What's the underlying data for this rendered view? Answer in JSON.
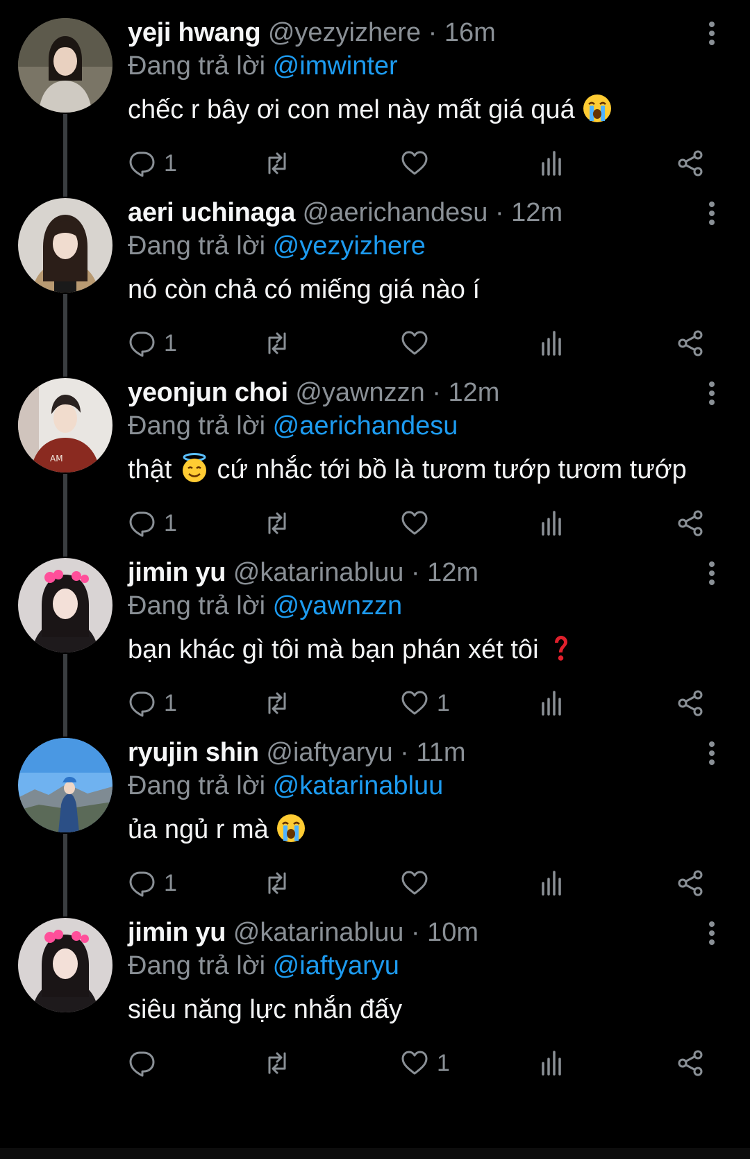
{
  "colors": {
    "background": "#000000",
    "name": "#f5f6f7",
    "muted": "#8a9096",
    "mention": "#1d9bf0",
    "thread_line": "#3a3d40"
  },
  "tweets": [
    {
      "name": "yeji hwang",
      "handle": "@yezyizhere",
      "separator": "·",
      "time": "16m",
      "reply_prefix": "Đang trả lời",
      "reply_to": "@imwinter",
      "text": "chếc r bây ơi con mel này mất giá quá",
      "text_after": "",
      "emoji": "loudly-crying-face",
      "reply_count": "1",
      "like_count": "",
      "avatar": "avatar-portrait-grey-sweater"
    },
    {
      "name": "aeri uchinaga",
      "handle": "@aerichandesu",
      "separator": "·",
      "time": "12m",
      "reply_prefix": "Đang trả lời",
      "reply_to": "@yezyizhere",
      "text": "nó còn chả có miếng giá nào í",
      "text_after": "",
      "emoji": "",
      "reply_count": "1",
      "like_count": "",
      "avatar": "avatar-portrait-long-hair"
    },
    {
      "name": "yeonjun choi",
      "handle": "@yawnzzn",
      "separator": "·",
      "time": "12m",
      "reply_prefix": "Đang trả lời",
      "reply_to": "@aerichandesu",
      "text": "thật",
      "text_after": "cứ nhắc tới bồ là tươm tướp tươm tướp",
      "emoji": "smiling-face-with-halo",
      "reply_count": "1",
      "like_count": "",
      "avatar": "avatar-portrait-red-hoodie"
    },
    {
      "name": "jimin yu",
      "handle": "@katarinabluu",
      "separator": "·",
      "time": "12m",
      "reply_prefix": "Đang trả lời",
      "reply_to": "@yawnzzn",
      "text": "bạn khác gì tôi mà bạn phán xét tôi",
      "text_after": "",
      "emoji": "red-question-mark",
      "reply_count": "1",
      "like_count": "1",
      "avatar": "avatar-portrait-pink-bow"
    },
    {
      "name": "ryujin shin",
      "handle": "@iaftyaryu",
      "separator": "·",
      "time": "11m",
      "reply_prefix": "Đang trả lời",
      "reply_to": "@katarinabluu",
      "text": "ủa ngủ r mà",
      "text_after": "",
      "emoji": "loudly-crying-face",
      "reply_count": "1",
      "like_count": "",
      "avatar": "avatar-landscape-blue-sky"
    },
    {
      "name": "jimin yu",
      "handle": "@katarinabluu",
      "separator": "·",
      "time": "10m",
      "reply_prefix": "Đang trả lời",
      "reply_to": "@iaftyaryu",
      "text": "siêu năng lực nhắn đấy",
      "text_after": "",
      "emoji": "",
      "reply_count": "",
      "like_count": "1",
      "avatar": "avatar-portrait-pink-bow"
    }
  ]
}
